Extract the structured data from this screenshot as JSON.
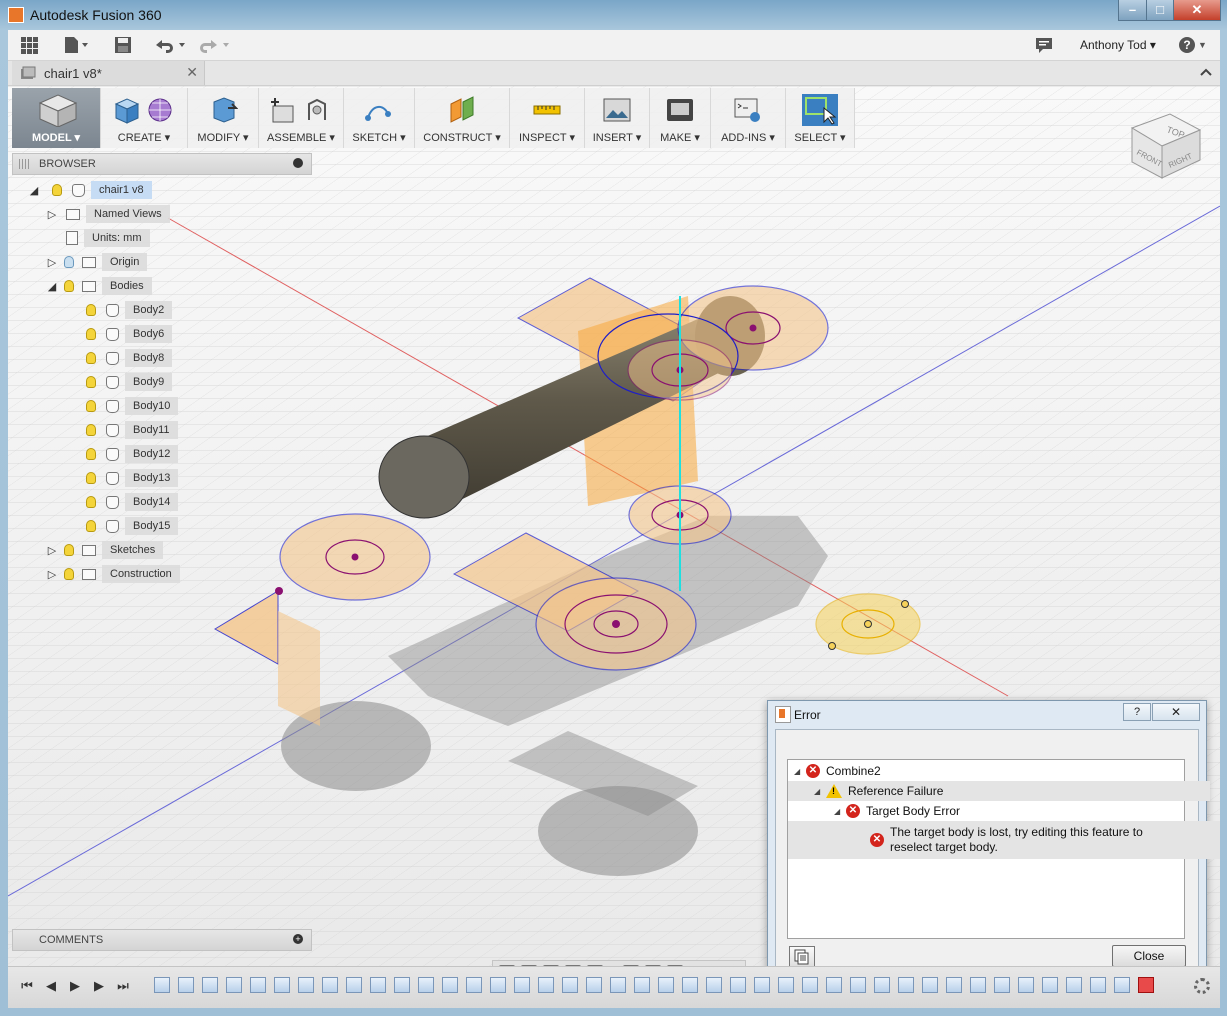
{
  "window": {
    "title": "Autodesk Fusion 360",
    "minimize": "–",
    "maximize": "□",
    "close": "✕"
  },
  "appbar": {
    "user_name": "Anthony Tod",
    "user_caret": "▾",
    "help": "?"
  },
  "document_tab": {
    "label": "chair1 v8*",
    "close": "✕"
  },
  "toolbar": {
    "model": "MODEL ▾",
    "create": "CREATE ▾",
    "modify": "MODIFY ▾",
    "assemble": "ASSEMBLE ▾",
    "sketch": "SKETCH ▾",
    "construct": "CONSTRUCT ▾",
    "inspect": "INSPECT ▾",
    "insert": "INSERT ▾",
    "make": "MAKE ▾",
    "addins": "ADD-INS ▾",
    "select": "SELECT ▾"
  },
  "browser": {
    "title": "BROWSER",
    "root": "chair1 v8",
    "named_views": "Named Views",
    "units": "Units: mm",
    "origin": "Origin",
    "bodies": "Bodies",
    "body_items": [
      "Body2",
      "Body6",
      "Body8",
      "Body9",
      "Body10",
      "Body11",
      "Body12",
      "Body13",
      "Body14",
      "Body15"
    ],
    "sketches": "Sketches",
    "construction": "Construction"
  },
  "comments": {
    "title": "COMMENTS"
  },
  "viewcube": {
    "top": "TOP",
    "front": "FRONT",
    "right": "RIGHT"
  },
  "error_dialog": {
    "title": "Error",
    "help": "?",
    "close_x": "✕",
    "items": [
      {
        "level": 0,
        "type": "error",
        "text": "Combine2"
      },
      {
        "level": 1,
        "type": "warning",
        "text": "Reference Failure"
      },
      {
        "level": 2,
        "type": "error",
        "text": "Target Body Error"
      }
    ],
    "message": "The target body is lost, try editing this feature to reselect target body.",
    "close_button": "Close"
  },
  "colors": {
    "accent_blue": "#3a7fc1",
    "error_red": "#d3241c",
    "warning_yellow": "#f2c200",
    "sketch_blue": "#1e1ec8",
    "plane_orange": "#f4b868"
  }
}
